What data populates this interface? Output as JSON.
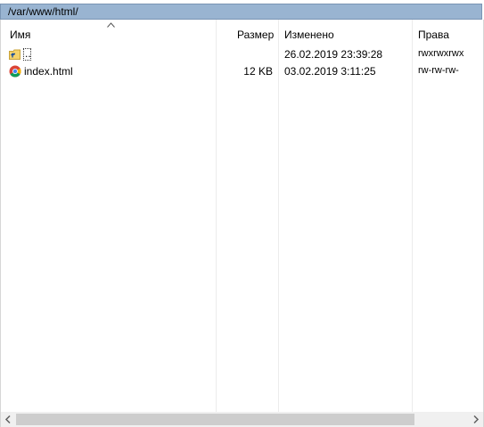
{
  "path_bar": {
    "path": "/var/www/html/"
  },
  "columns": {
    "name": "Имя",
    "size": "Размер",
    "modified": "Изменено",
    "permissions": "Права"
  },
  "sort": {
    "column": "name",
    "direction": "ascending"
  },
  "rows": [
    {
      "name": "..",
      "icon": "parent-folder-icon",
      "size": "",
      "modified": "26.02.2019 23:39:28",
      "permissions": "rwxrwxrwx"
    },
    {
      "name": "index.html",
      "icon": "chrome-icon",
      "size": "12 KB",
      "modified": "03.02.2019 3:11:25",
      "permissions": "rw-rw-rw-"
    }
  ],
  "colors": {
    "path_bar": "#99b4d1",
    "scrollbar_thumb": "#cdcdcd",
    "scrollbar_track": "#f0f0f0"
  }
}
